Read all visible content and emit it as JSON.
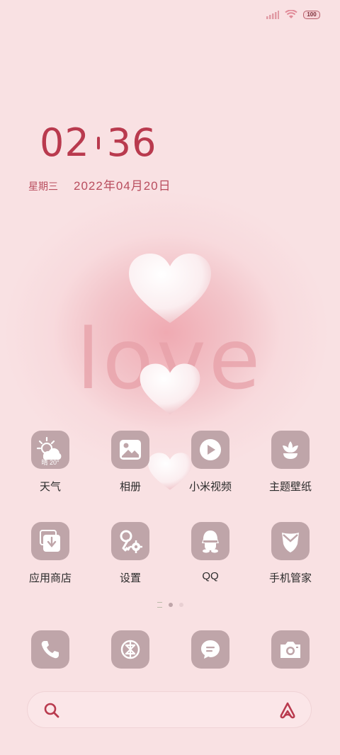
{
  "status": {
    "battery": "100",
    "icons": [
      "signal-icon",
      "wifi-icon",
      "battery-icon"
    ]
  },
  "clock": {
    "hour": "02",
    "minute": "36",
    "weekday": "星期三",
    "date": "2022年04月20日"
  },
  "wallpaper": {
    "text": "love"
  },
  "apps": [
    {
      "label": "天气",
      "icon": "weather-icon",
      "temp": "晴 20°"
    },
    {
      "label": "相册",
      "icon": "gallery-icon"
    },
    {
      "label": "小米视频",
      "icon": "video-icon"
    },
    {
      "label": "主题壁纸",
      "icon": "theme-icon"
    },
    {
      "label": "应用商店",
      "icon": "app-store-icon"
    },
    {
      "label": "设置",
      "icon": "settings-icon"
    },
    {
      "label": "QQ",
      "icon": "qq-icon"
    },
    {
      "label": "手机管家",
      "icon": "security-icon"
    }
  ],
  "dock": [
    "phone-icon",
    "browser-icon",
    "messages-icon",
    "camera-icon"
  ],
  "pager": {
    "pages": 3,
    "current": 1
  },
  "colors": {
    "accent": "#b93a4e",
    "tile": "#bfa5a9",
    "background": "#f9e1e3"
  }
}
